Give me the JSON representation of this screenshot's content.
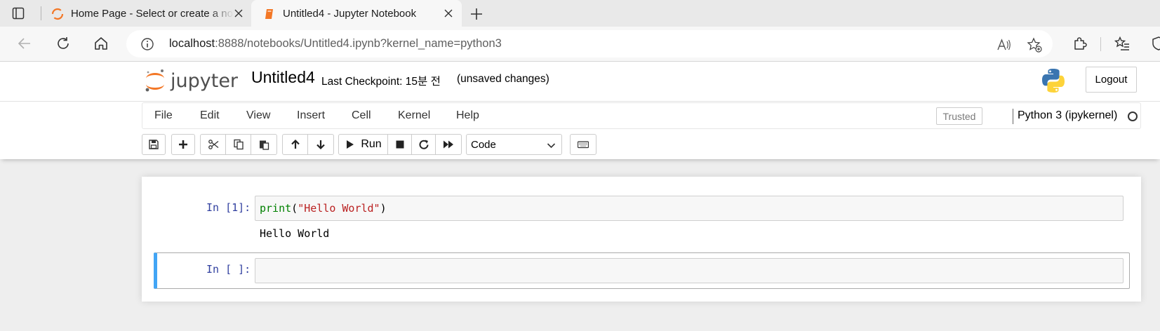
{
  "browser": {
    "tabs": [
      {
        "title": "Home Page - Select or create a notebook",
        "icon": "jupyter-favicon-icon",
        "active": false
      },
      {
        "title": "Untitled4 - Jupyter Notebook",
        "icon": "notebook-favicon-icon",
        "active": true
      }
    ],
    "url_host": "localhost",
    "url_rest": ":8888/notebooks/Untitled4.ipynb?kernel_name=python3"
  },
  "header": {
    "logo_text": "jupyter",
    "notebook_name": "Untitled4",
    "checkpoint": "Last Checkpoint: 15분 전",
    "status": "(unsaved changes)",
    "logout_label": "Logout"
  },
  "menubar": {
    "items": [
      "File",
      "Edit",
      "View",
      "Insert",
      "Cell",
      "Kernel",
      "Help"
    ],
    "trusted_label": "Trusted",
    "kernel_name": "Python 3 (ipykernel)"
  },
  "toolbar": {
    "run_label": "Run",
    "cell_type": "Code"
  },
  "cells": [
    {
      "prompt": "In [1]:",
      "code_fn": "print",
      "code_open": "(",
      "code_str": "\"Hello World\"",
      "code_close": ")",
      "output": "Hello World"
    },
    {
      "prompt": "In [ ]:",
      "code": ""
    }
  ],
  "colors": {
    "accent_selected": "#42a5f5",
    "prompt": "#303f9f",
    "jupyter_orange": "#f37726"
  }
}
